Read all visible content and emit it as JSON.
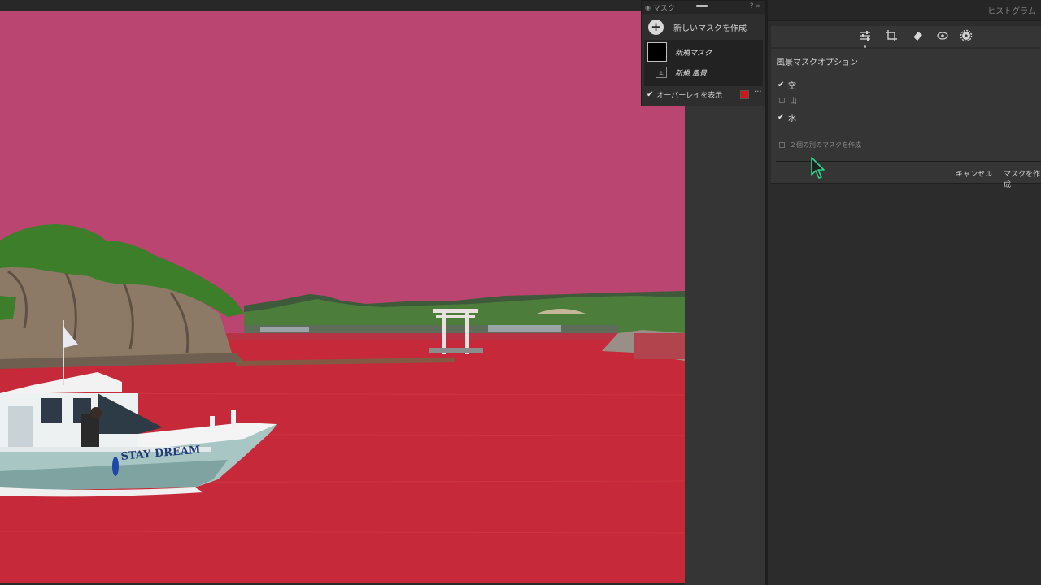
{
  "mask_panel": {
    "title": "マスク",
    "new_mask_label": "新しいマスクを作成",
    "items": [
      {
        "label": "新規マスク"
      },
      {
        "label": "新規 風景"
      }
    ],
    "overlay_label": "オーバーレイを表示",
    "overlay_checked": true,
    "overlay_color": "#d01818",
    "more_label": "···"
  },
  "right_panel": {
    "header": "ヒストグラム",
    "tool_icons": [
      "sliders-icon",
      "crop-icon",
      "eraser-icon",
      "redeye-icon",
      "gear-icon"
    ],
    "options_title": "風景マスクオプション",
    "options": [
      {
        "label": "空",
        "checked": true
      },
      {
        "label": "山",
        "checked": false
      },
      {
        "label": "水",
        "checked": true
      }
    ],
    "separate_label": "２個の別のマスクを作成",
    "separate_checked": false,
    "cancel_label": "キャンセル",
    "create_label": "マスクを作成"
  },
  "photo": {
    "boat_name": "STAY DREAM",
    "sky_overlay": "#b94570",
    "water_overlay": "#c62a3a"
  }
}
